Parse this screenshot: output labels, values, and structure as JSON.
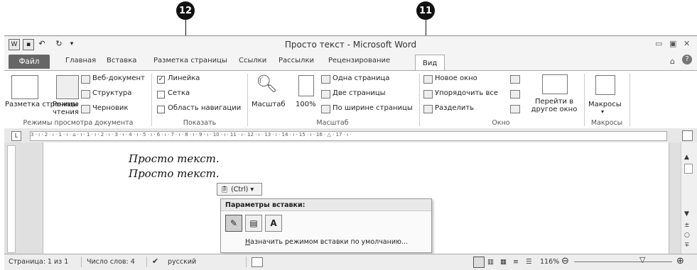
{
  "callouts": {
    "left": "12",
    "right": "11"
  },
  "app": {
    "title": "Просто текст - Microsoft Word"
  },
  "tabs": [
    "Файл",
    "Главная",
    "Вставка",
    "Разметка страницы",
    "Ссылки",
    "Рассылки",
    "Рецензирование",
    "Вид"
  ],
  "ribbon": {
    "views": {
      "print_layout": "Разметка страницы",
      "reading": "Режим чтения",
      "web": "Веб-документ",
      "outline": "Структура",
      "draft": "Черновик",
      "group": "Режимы просмотра документа"
    },
    "show": {
      "ruler": "Линейка",
      "grid": "Сетка",
      "nav": "Область навигации",
      "ruler_checked": true,
      "group": "Показать"
    },
    "zoom": {
      "zoom": "Масштаб",
      "percent": "100%",
      "one_page": "Одна страница",
      "two_pages": "Две страницы",
      "page_width": "По ширине страницы",
      "group": "Масштаб"
    },
    "window": {
      "new": "Новое окно",
      "arrange": "Упорядочить все",
      "split": "Разделить",
      "switch": "Перейти в другое окно",
      "group": "Окно"
    },
    "macros": {
      "label": "Макросы",
      "group": "Макросы"
    }
  },
  "ruler_text": "3 · ı · 2 · ı · 1 · ı · ⌂ · ı · 1 · ı · 2 · ı · 3 · ı · 4 · ı · 5 · ı · 6 · ı · 7 · ı · 8 · ı · 9 · ı · 10 · ı · 11 · ı · 12 · ı · 13 · ı · 14 · ı · 15 · ı · 16 · △ · 17 · ı ·",
  "document": {
    "lines": [
      "Просто текст.",
      "Просто текст."
    ]
  },
  "paste": {
    "chip": "(Ctrl)",
    "title": "Параметры вставки:",
    "text_only": "A",
    "set_default": "Назначить режимом вставки по умолчанию..."
  },
  "status": {
    "page": "Страница: 1 из 1",
    "words": "Число слов: 4",
    "lang": "русский",
    "zoom": "116%"
  }
}
